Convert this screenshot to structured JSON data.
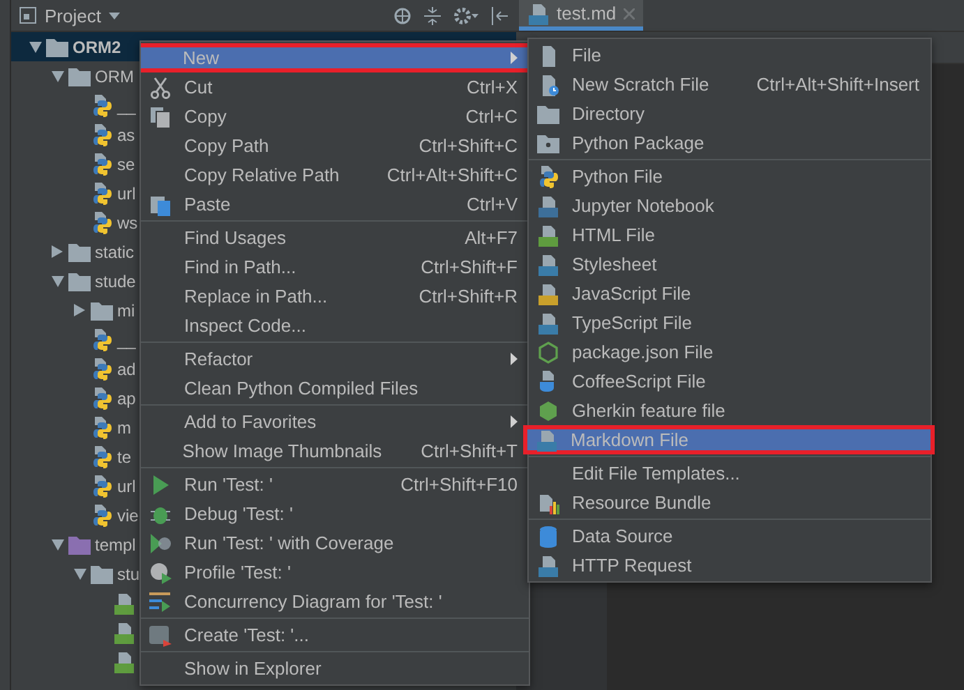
{
  "project_panel": {
    "title": "Project",
    "tree": [
      {
        "label": "ORM2",
        "kind": "folder",
        "bold": true,
        "selected": true,
        "expanded": true,
        "children": [
          {
            "label": "ORM",
            "kind": "folder",
            "selected": false,
            "expanded": true,
            "children": [
              {
                "label": "__",
                "kind": "python",
                "selected": false
              },
              {
                "label": "as",
                "kind": "python",
                "selected": false
              },
              {
                "label": "se",
                "kind": "python",
                "selected": false
              },
              {
                "label": "url",
                "kind": "python",
                "selected": false
              },
              {
                "label": "ws",
                "kind": "python",
                "selected": false
              }
            ]
          },
          {
            "label": "static",
            "kind": "folder",
            "selected": false,
            "expanded": false
          },
          {
            "label": "stude",
            "kind": "folder",
            "selected": false,
            "expanded": true,
            "children": [
              {
                "label": "mi",
                "kind": "folder",
                "selected": false,
                "expanded": false
              },
              {
                "label": "__",
                "kind": "python",
                "selected": false
              },
              {
                "label": "ad",
                "kind": "python",
                "selected": false
              },
              {
                "label": "ap",
                "kind": "python",
                "selected": false
              },
              {
                "label": "m",
                "kind": "python",
                "selected": false
              },
              {
                "label": "te",
                "kind": "python",
                "selected": false
              },
              {
                "label": "url",
                "kind": "python",
                "selected": false
              },
              {
                "label": "vie",
                "kind": "python",
                "selected": false
              }
            ]
          },
          {
            "label": "templ",
            "kind": "templates",
            "selected": false,
            "expanded": true,
            "children": [
              {
                "label": "stu",
                "kind": "folder",
                "selected": false,
                "expanded": true,
                "children": [
                  {
                    "kind": "html",
                    "selected": false
                  },
                  {
                    "kind": "html",
                    "selected": false
                  },
                  {
                    "kind": "html",
                    "selected": false
                  }
                ]
              }
            ]
          }
        ]
      }
    ]
  },
  "editor": {
    "tab": "test.md"
  },
  "context_menu": [
    {
      "kind": "item",
      "label": "New",
      "submenu": true,
      "selected": true,
      "annotated": true
    },
    {
      "kind": "item",
      "label": "Cut",
      "shortcut": "Ctrl+X",
      "selected": false,
      "annotated": false
    },
    {
      "kind": "item",
      "label": "Copy",
      "shortcut": "Ctrl+C",
      "selected": false,
      "annotated": false
    },
    {
      "kind": "item",
      "label": "Copy Path",
      "shortcut": "Ctrl+Shift+C",
      "selected": false,
      "annotated": false
    },
    {
      "kind": "item",
      "label": "Copy Relative Path",
      "shortcut": "Ctrl+Alt+Shift+C",
      "selected": false,
      "annotated": false
    },
    {
      "kind": "item",
      "label": "Paste",
      "shortcut": "Ctrl+V",
      "selected": false,
      "annotated": false
    },
    {
      "kind": "separator"
    },
    {
      "kind": "item",
      "label": "Find Usages",
      "shortcut": "Alt+F7",
      "selected": false,
      "annotated": false
    },
    {
      "kind": "item",
      "label": "Find in Path...",
      "shortcut": "Ctrl+Shift+F",
      "selected": false,
      "annotated": false
    },
    {
      "kind": "item",
      "label": "Replace in Path...",
      "shortcut": "Ctrl+Shift+R",
      "selected": false,
      "annotated": false
    },
    {
      "kind": "item",
      "label": "Inspect Code...",
      "selected": false,
      "annotated": false
    },
    {
      "kind": "separator"
    },
    {
      "kind": "item",
      "label": "Refactor",
      "submenu": true,
      "selected": false,
      "annotated": false
    },
    {
      "kind": "item",
      "label": "Clean Python Compiled Files",
      "selected": false,
      "annotated": false
    },
    {
      "kind": "separator"
    },
    {
      "kind": "item",
      "label": "Add to Favorites",
      "submenu": true,
      "selected": false,
      "annotated": false
    },
    {
      "kind": "item",
      "label": "Show Image Thumbnails",
      "shortcut": "Ctrl+Shift+T",
      "selected": false,
      "annotated": false
    },
    {
      "kind": "separator"
    },
    {
      "kind": "item",
      "label": "Run 'Test: '",
      "shortcut": "Ctrl+Shift+F10",
      "selected": false,
      "annotated": false
    },
    {
      "kind": "item",
      "label": "Debug 'Test: '",
      "selected": false,
      "annotated": false
    },
    {
      "kind": "item",
      "label": "Run 'Test: ' with Coverage",
      "selected": false,
      "annotated": false
    },
    {
      "kind": "item",
      "label": "Profile 'Test: '",
      "selected": false,
      "annotated": false
    },
    {
      "kind": "item",
      "label": "Concurrency Diagram for 'Test: '",
      "selected": false,
      "annotated": false
    },
    {
      "kind": "separator"
    },
    {
      "kind": "item",
      "label": "Create 'Test: '...",
      "selected": false,
      "annotated": false
    },
    {
      "kind": "separator"
    },
    {
      "kind": "item",
      "label": "Show in Explorer",
      "selected": false,
      "annotated": false
    }
  ],
  "new_submenu": [
    {
      "kind": "item",
      "label": "File",
      "selected": false,
      "annotated": false
    },
    {
      "kind": "item",
      "label": "New Scratch File",
      "shortcut": "Ctrl+Alt+Shift+Insert",
      "selected": false,
      "annotated": false
    },
    {
      "kind": "item",
      "label": "Directory",
      "selected": false,
      "annotated": false
    },
    {
      "kind": "item",
      "label": "Python Package",
      "selected": false,
      "annotated": false
    },
    {
      "kind": "separator"
    },
    {
      "kind": "item",
      "label": "Python File",
      "selected": false,
      "annotated": false
    },
    {
      "kind": "item",
      "label": "Jupyter Notebook",
      "selected": false,
      "annotated": false
    },
    {
      "kind": "item",
      "label": "HTML File",
      "selected": false,
      "annotated": false
    },
    {
      "kind": "item",
      "label": "Stylesheet",
      "selected": false,
      "annotated": false
    },
    {
      "kind": "item",
      "label": "JavaScript File",
      "selected": false,
      "annotated": false
    },
    {
      "kind": "item",
      "label": "TypeScript File",
      "selected": false,
      "annotated": false
    },
    {
      "kind": "item",
      "label": "package.json File",
      "selected": false,
      "annotated": false
    },
    {
      "kind": "item",
      "label": "CoffeeScript File",
      "selected": false,
      "annotated": false
    },
    {
      "kind": "item",
      "label": "Gherkin feature file",
      "selected": false,
      "annotated": false
    },
    {
      "kind": "item",
      "label": "Markdown File",
      "selected": true,
      "annotated": true
    },
    {
      "kind": "separator"
    },
    {
      "kind": "item",
      "label": "Edit File Templates...",
      "selected": false,
      "annotated": false
    },
    {
      "kind": "item",
      "label": "Resource Bundle",
      "selected": false,
      "annotated": false
    },
    {
      "kind": "separator"
    },
    {
      "kind": "item",
      "label": "Data Source",
      "selected": false,
      "annotated": false
    },
    {
      "kind": "item",
      "label": "HTTP Request",
      "selected": false,
      "annotated": false
    }
  ]
}
